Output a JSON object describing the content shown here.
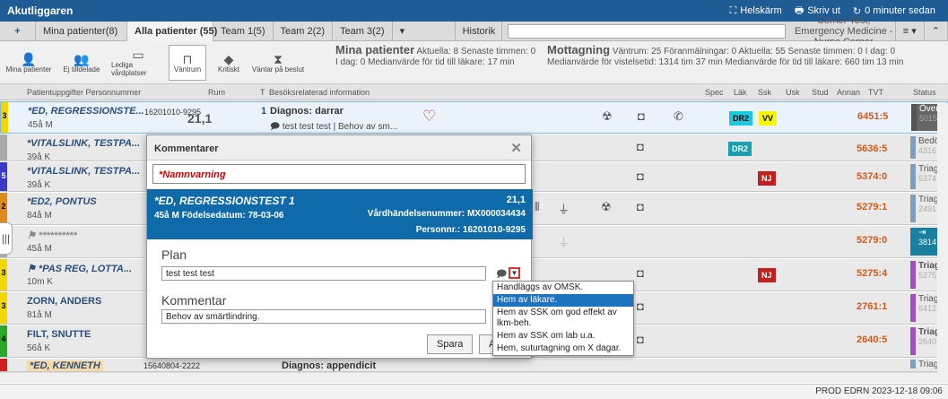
{
  "app": {
    "title": "Akutliggaren"
  },
  "topbar": {
    "fullscreen": "Helskärm",
    "print": "Skriv ut",
    "updated": "0 minuter sedan"
  },
  "tabs": [
    {
      "label": "Mina patienter(8)"
    },
    {
      "label": "Alla patienter (55)"
    },
    {
      "label": "Team 1(5)"
    },
    {
      "label": "Team 2(2)"
    },
    {
      "label": "Team 3(2)"
    },
    {
      "label": "Historik"
    }
  ],
  "context": "Cerner Test, Emergency Medicine - Nurse Cerner",
  "toolbar": {
    "b1": "Mina patienter",
    "b2": "Ej tilldelade",
    "b3": "Lediga vårdplatser",
    "b4": "Väntrum",
    "b5": "Kritiskt",
    "b6": "Väntar på beslut"
  },
  "stats": {
    "mina_title": "Mina patienter",
    "mina_line1": "Aktuella: 8  Senaste timmen: 0",
    "mina_line2": "I dag: 0  Medianvärde för tid till läkare: 17 min",
    "mott_title": "Mottagning",
    "mott_line1": "Väntrum: 25  Föranmälningar: 0  Aktuella: 55  Senaste timmen: 0  I dag: 0",
    "mott_line2": "Medianvärde för vistelsetid: 1314 tim 37 min  Medianvärde för tid till läkare: 660 tim 13 min"
  },
  "columns": {
    "patient": "Patientuppgifter Personnummer",
    "room": "Rum",
    "t": "T",
    "info": "Besöksrelaterad information",
    "spec": "Spec",
    "lak": "Läk",
    "ssk": "Ssk",
    "usk": "Usk",
    "stud": "Stud",
    "annan": "Annan",
    "tvt": "TVT",
    "status": "Status"
  },
  "rows": [
    {
      "prio": "3",
      "name": "*ED, REGRESSIONSTE...",
      "age": "45å M",
      "pnr": "16201010-9295",
      "room": "21,1",
      "t": "1",
      "diag": "Diagnos: darrar",
      "comment": "test test test",
      "comment2": "Behov av sm...",
      "badge1": "DR2",
      "badge2": "VV",
      "tvt": "6451:5",
      "status": "Över",
      "status2": "5015"
    },
    {
      "prio": "",
      "name": "*VITALSLINK, TESTPA...",
      "age": "39å K",
      "badge1": "DR2",
      "tvt": "5636:5",
      "status": "Bedö",
      "status2": "4316"
    },
    {
      "prio": "5",
      "name": "*VITALSLINK, TESTPA...",
      "age": "39å K",
      "badge1": "NJ",
      "tvt": "5374:0",
      "status": "Triag",
      "status2": "5374"
    },
    {
      "prio": "2",
      "name": "*ED2, PONTUS",
      "age": "84å M",
      "tvt": "5279:1",
      "status": "Triag",
      "status2": "2491"
    },
    {
      "prio": "",
      "name": "**********",
      "age": "45å M",
      "tvt": "5279:0",
      "status": "",
      "status2": "3814"
    },
    {
      "prio": "3",
      "name": "*PAS REG, LOTTA...",
      "age": "10m K",
      "badge1": "NJ",
      "tvt": "5275:4",
      "status": "Triag",
      "status2": "5275"
    },
    {
      "prio": "3",
      "name": "ZORN, ANDERS",
      "age": "81å M",
      "tvt": "2761:1",
      "status": "Triag",
      "status2": "6412"
    },
    {
      "prio": "4",
      "name": "FILT, SNUTTE",
      "age": "56å K",
      "tvt": "2640:5",
      "status": "Triag",
      "status2": "2640"
    },
    {
      "prio": "",
      "name": "*ED, KENNETH",
      "age": "",
      "pnr": "15640804-2222",
      "diag": "Diagnos: appendicit",
      "tvt": "",
      "status": "Triag",
      "status2": ""
    }
  ],
  "dialog": {
    "title": "Kommentarer",
    "warning": "*Namnvarning",
    "patient_name": "*ED, REGRESSIONSTEST 1",
    "room": "21,1",
    "patient_info": "45å   M   Födelsedatum: 78-03-06",
    "visit_no": "Vårdhändelsenummer: MX000034434",
    "pnr": "Personnr.: 16201010-9295",
    "plan_label": "Plan",
    "plan_value": "test test test",
    "comment_label": "Kommentar",
    "comment_value": "Behov av smärtlindring.",
    "save": "Spara",
    "cancel": "A"
  },
  "dropdown": {
    "options": [
      "Handläggs av OMSK.",
      "Hem av läkare.",
      "Hem av SSK om god effekt av lkm-beh.",
      "Hem av SSK om lab u.a.",
      "Hem, suturtagning om X dagar."
    ],
    "selected_index": 1
  },
  "footer": {
    "text": "PROD  EDRN  2023-12-18  09:06"
  },
  "colors": {
    "accent": "#1f5b94",
    "band": "#0f6aa9",
    "tvt": "#d05a1a"
  }
}
